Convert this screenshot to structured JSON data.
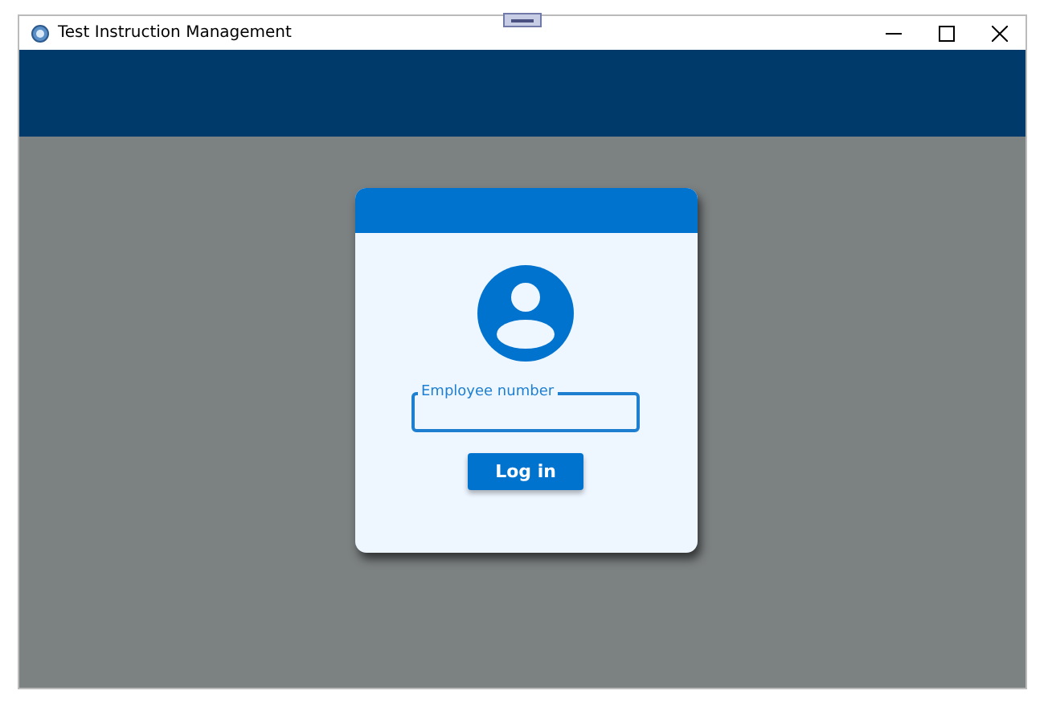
{
  "window": {
    "title": "Test Instruction Management"
  },
  "login": {
    "field": {
      "label": "Employee number"
    },
    "button": "Log in"
  }
}
